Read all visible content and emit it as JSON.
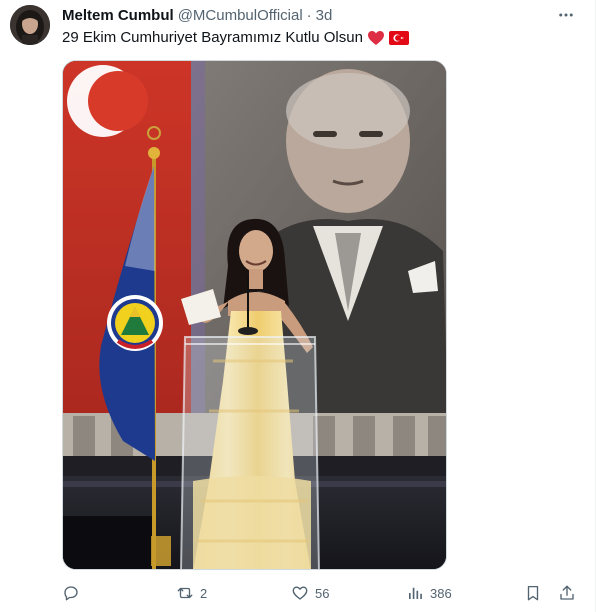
{
  "author": {
    "name": "Meltem Cumbul",
    "handle": "@MCumbulOfficial",
    "separator": "·",
    "time": "3d"
  },
  "tweet": {
    "text": "29 Ekim Cumhuriyet Bayramımız Kutlu Olsun",
    "emojis": [
      "red-heart-icon",
      "turkey-flag-icon"
    ]
  },
  "media": {
    "alt": "Photo of a woman speaking at a podium in front of a large portrait and flags"
  },
  "actions": {
    "reply_count": "",
    "retweet_count": "2",
    "like_count": "56",
    "views_count": "386"
  },
  "colors": {
    "text_primary": "#0f1419",
    "text_secondary": "#536471",
    "heart": "#e0245e",
    "flag_red": "#e30a17"
  }
}
